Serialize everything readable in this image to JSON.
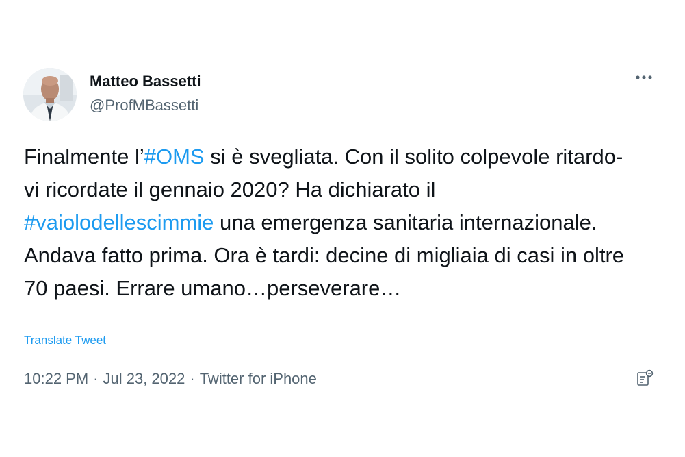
{
  "author": {
    "display_name": "Matteo Bassetti",
    "handle": "@ProfMBassetti",
    "avatar_icon": "profile-photo"
  },
  "tweet": {
    "text_parts": [
      {
        "text": "Finalmente l’",
        "type": "text"
      },
      {
        "text": "#OMS",
        "type": "hashtag"
      },
      {
        "text": " si è svegliata. Con il solito colpevole ritardo- vi ricordate il gennaio 2020? Ha dichiarato il ",
        "type": "text"
      },
      {
        "text": "#vaiolodellescimmie",
        "type": "hashtag"
      },
      {
        "text": " una emergenza sanitaria internazionale. Andava fatto prima. Ora è tardi: decine di migliaia di casi in oltre 70 paesi. Errare umano…perseverare…",
        "type": "text"
      }
    ],
    "translate_label": "Translate Tweet"
  },
  "meta": {
    "time": "10:22 PM",
    "separator": "·",
    "date": "Jul 23, 2022",
    "source": "Twitter for iPhone"
  },
  "icons": {
    "more": "more-horizontal-icon",
    "analytics": "tweet-analytics-icon"
  },
  "colors": {
    "hashtag": "#1d9bf0",
    "secondary_text": "#536471",
    "primary_text": "#0f1419"
  }
}
